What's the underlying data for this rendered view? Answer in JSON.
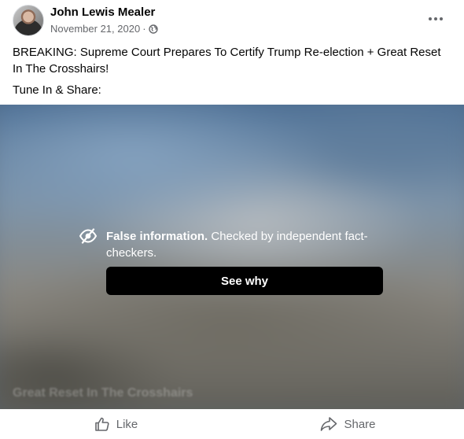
{
  "post": {
    "author": "John Lewis Mealer",
    "date": "November 21, 2020",
    "separator": " · ",
    "privacy_icon": "globe-icon",
    "menu_icon": "more-options-icon",
    "text_lines": [
      "BREAKING: Supreme Court Prepares To Certify Trump Re-election + Great Reset In The Crosshairs!",
      "Tune In & Share:"
    ]
  },
  "media": {
    "caption": "Great Reset In The Crosshairs",
    "notice": {
      "icon": "eye-slash-icon",
      "bold": "False information.",
      "detail": " Checked by independent fact-checkers."
    },
    "button_label": "See why"
  },
  "actions": {
    "like_label": "Like",
    "like_icon": "thumbs-up-icon",
    "share_label": "Share",
    "share_icon": "share-arrow-icon"
  },
  "colors": {
    "secondary_text": "#65676b",
    "button_bg": "#000000",
    "text": "#050505"
  }
}
